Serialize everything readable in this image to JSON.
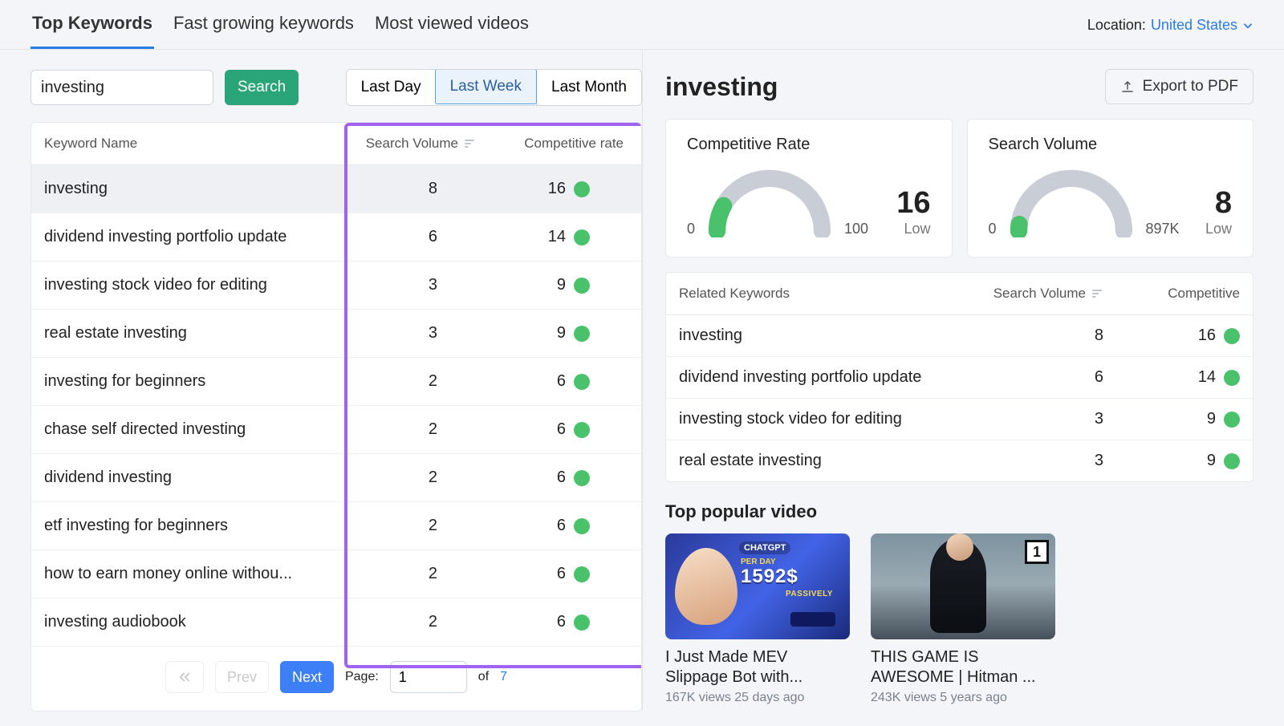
{
  "tabs": [
    "Top Keywords",
    "Fast growing keywords",
    "Most viewed videos"
  ],
  "activeTabIndex": 0,
  "location": {
    "label": "Location:",
    "value": "United States"
  },
  "search": {
    "value": "investing",
    "button": "Search"
  },
  "duration": {
    "options": [
      "Last Day",
      "Last Week",
      "Last Month"
    ],
    "activeIndex": 1
  },
  "table": {
    "headers": {
      "name": "Keyword Name",
      "sv": "Search Volume",
      "comp": "Competitive rate"
    },
    "rows": [
      {
        "name": "investing",
        "sv": "8",
        "comp": "16"
      },
      {
        "name": "dividend investing portfolio update",
        "sv": "6",
        "comp": "14"
      },
      {
        "name": "investing stock video for editing",
        "sv": "3",
        "comp": "9"
      },
      {
        "name": "real estate investing",
        "sv": "3",
        "comp": "9"
      },
      {
        "name": "investing for beginners",
        "sv": "2",
        "comp": "6"
      },
      {
        "name": "chase self directed investing",
        "sv": "2",
        "comp": "6"
      },
      {
        "name": "dividend investing",
        "sv": "2",
        "comp": "6"
      },
      {
        "name": "etf investing for beginners",
        "sv": "2",
        "comp": "6"
      },
      {
        "name": "how to earn money online withou...",
        "sv": "2",
        "comp": "6"
      },
      {
        "name": "investing audiobook",
        "sv": "2",
        "comp": "6"
      }
    ],
    "selectedRowIndex": 0
  },
  "pager": {
    "prev": "Prev",
    "next": "Next",
    "pageLabel": "Page:",
    "page": "1",
    "of": "of",
    "total": "7"
  },
  "detail": {
    "title": "investing",
    "export": "Export to PDF",
    "gauges": [
      {
        "title": "Competitive Rate",
        "value": "16",
        "label": "Low",
        "min": "0",
        "max": "100",
        "fillPct": 16
      },
      {
        "title": "Search Volume",
        "value": "8",
        "label": "Low",
        "min": "0",
        "max": "897K",
        "fillPct": 4
      }
    ]
  },
  "related": {
    "headers": {
      "name": "Related Keywords",
      "sv": "Search Volume",
      "comp": "Competitive"
    },
    "rows": [
      {
        "name": "investing",
        "sv": "8",
        "comp": "16"
      },
      {
        "name": "dividend investing portfolio update",
        "sv": "6",
        "comp": "14"
      },
      {
        "name": "investing stock video for editing",
        "sv": "3",
        "comp": "9"
      },
      {
        "name": "real estate investing",
        "sv": "3",
        "comp": "9"
      }
    ]
  },
  "videos": {
    "title": "Top popular video",
    "items": [
      {
        "title": "I Just Made MEV Slippage Bot with...",
        "meta": "167K views 25 days ago",
        "thumb": {
          "txt1": "CHATGPT",
          "txt2": "1592$",
          "txt3": "PER DAY",
          "txt4": "PASSIVELY"
        }
      },
      {
        "title": "THIS GAME IS AWESOME | Hitman ...",
        "meta": "243K views 5 years ago",
        "thumb": {
          "badge": "1"
        }
      }
    ]
  }
}
